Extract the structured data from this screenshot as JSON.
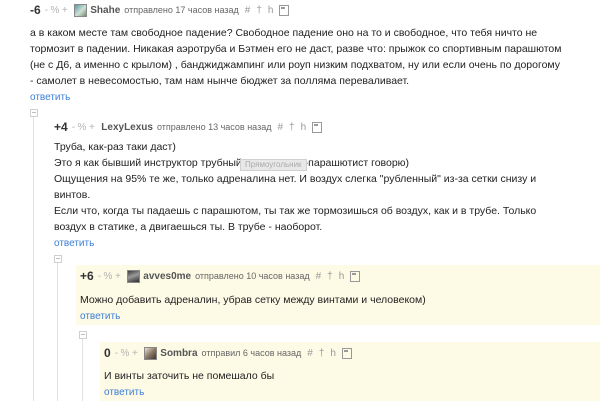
{
  "comments": [
    {
      "rating": "-6",
      "votes": [
        "-",
        "%",
        "+"
      ],
      "username": "Shahe",
      "meta": "отправлено 17 часов назад",
      "tools": [
        "#",
        "†",
        "h"
      ],
      "lines": [
        "а в каком месте там свободное падение? Свободное падение оно на то и свободное, что тебя ничто не",
        "тормозит в падении. Никакая аэротруба и Бэтмен его не даст, разве что: прыжок со спортивным парашютом",
        "(не с Д6, а именно с крылом) , банджиджампинг или роуп низким подхватом, ну или если очень по дорогому",
        "- самолет в невесомостью, там нам нынче бюджет за полляма переваливает."
      ],
      "reply": "ответить"
    },
    {
      "rating": "+4",
      "votes": [
        "-",
        "%",
        "+"
      ],
      "username": "LexyLexus",
      "meta": "отправлено 13 часов назад",
      "tools": [
        "#",
        "†",
        "h"
      ],
      "lines": [
        "Труба, как-раз таки даст)",
        "Это я как бывший инструктор трубный и спортсмен-парашютист говорю)",
        "Ощущения на 95% те же, только адреналина нет. И воздух слегка \"рубленный\" из-за сетки снизу и",
        "винтов.",
        "Если что, когда ты падаешь с парашютом, ты так же тормозишься об воздух, как и в трубе. Только",
        "воздух в статике, а двигаешься ты. В трубе - наоборот."
      ],
      "reply": "ответить",
      "tooltip": "Прямоугольник"
    },
    {
      "rating": "+6",
      "votes": [
        "-",
        "%",
        "+"
      ],
      "username": "avves0me",
      "meta": "отправлено 10 часов назад",
      "tools": [
        "#",
        "†",
        "h"
      ],
      "lines": [
        "Можно добавить адреналин, убрав сетку между винтами и человеком)"
      ],
      "reply": "ответить"
    },
    {
      "rating": "0",
      "votes": [
        "-",
        "%",
        "+"
      ],
      "username": "Sombra",
      "meta": "отправил 6 часов назад",
      "tools": [
        "#",
        "†",
        "h"
      ],
      "lines": [
        "И винты заточить не помешало бы"
      ],
      "reply": "ответить"
    }
  ],
  "colors": {
    "link": "#3a7fd8",
    "highlight_bg": "#fdfae6",
    "thread_line": "#e2e2e2"
  }
}
